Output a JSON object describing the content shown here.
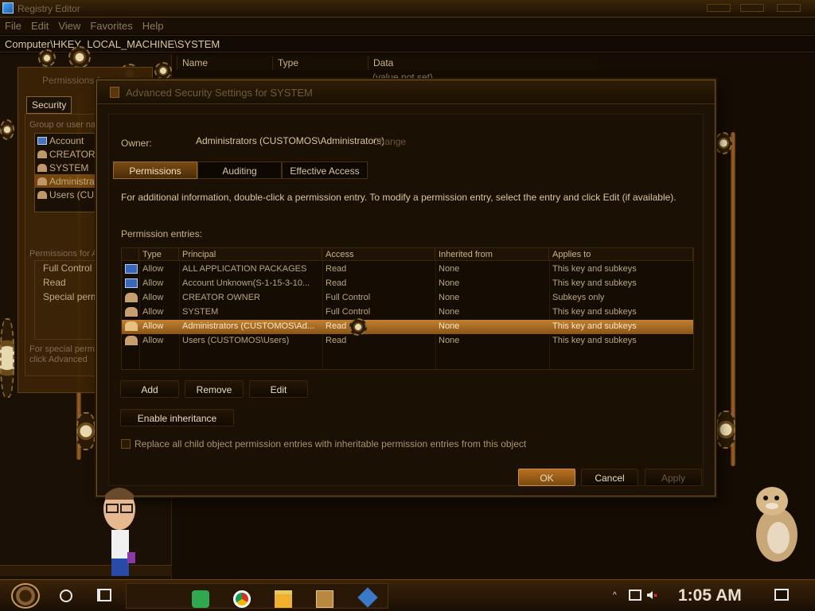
{
  "registry": {
    "title": "Registry Editor",
    "menu": [
      "File",
      "Edit",
      "View",
      "Favorites",
      "Help"
    ],
    "address": "Computer\\HKEY_LOCAL_MACHINE\\SYSTEM",
    "columns": [
      "Name",
      "Type",
      "Data"
    ],
    "value_data": "(value not set)"
  },
  "permissions_dialog": {
    "title": "Permissions for",
    "tab": "Security",
    "group_label": "Group or user na",
    "users": [
      "Account",
      "CREATOR",
      "SYSTEM",
      "Administrato",
      "Users (CUS"
    ],
    "selected_user_index": 3,
    "permissions_label": "Permissions for A",
    "permissions": [
      "Full Control",
      "Read",
      "Special permi"
    ],
    "note_line1": "For special perm",
    "note_line2": "click Advanced"
  },
  "advanced": {
    "title": "Advanced Security Settings for SYSTEM",
    "owner_label": "Owner:",
    "owner_value": "Administrators (CUSTOMOS\\Administrators)",
    "change_label": "Change",
    "tabs": [
      "Permissions",
      "Auditing",
      "Effective Access"
    ],
    "active_tab": "Permissions",
    "info": "For additional information, double-click a permission entry. To modify a permission entry, select the entry and click Edit (if available).",
    "entries_label": "Permission entries:",
    "table": {
      "headers": [
        "Type",
        "Principal",
        "Access",
        "Inherited from",
        "Applies to"
      ],
      "rows": [
        {
          "icon": "package-icon",
          "type": "Allow",
          "principal": "ALL APPLICATION PACKAGES",
          "access": "Read",
          "inherited": "None",
          "applies": "This key and subkeys"
        },
        {
          "icon": "package-icon",
          "type": "Allow",
          "principal": "Account Unknown(S-1-15-3-10...",
          "access": "Read",
          "inherited": "None",
          "applies": "This key and subkeys"
        },
        {
          "icon": "users-icon",
          "type": "Allow",
          "principal": "CREATOR OWNER",
          "access": "Full Control",
          "inherited": "None",
          "applies": "Subkeys only"
        },
        {
          "icon": "users-icon",
          "type": "Allow",
          "principal": "SYSTEM",
          "access": "Full Control",
          "inherited": "None",
          "applies": "This key and subkeys"
        },
        {
          "icon": "users-icon",
          "type": "Allow",
          "principal": "Administrators (CUSTOMOS\\Ad...",
          "access": "Read",
          "inherited": "None",
          "applies": "This key and subkeys"
        },
        {
          "icon": "users-icon",
          "type": "Allow",
          "principal": "Users (CUSTOMOS\\Users)",
          "access": "Read",
          "inherited": "None",
          "applies": "This key and subkeys"
        }
      ],
      "selected_index": 4
    },
    "buttons": {
      "add": "Add",
      "remove": "Remove",
      "edit": "Edit",
      "enable_inheritance": "Enable inheritance",
      "ok": "OK",
      "cancel": "Cancel",
      "apply": "Apply"
    },
    "replace_label": "Replace all child object permission entries with inheritable permission entries from this object"
  },
  "taskbar": {
    "time": "1:05 AM"
  },
  "colors": {
    "accent": "#b87020",
    "selected_row": "#c08030"
  }
}
